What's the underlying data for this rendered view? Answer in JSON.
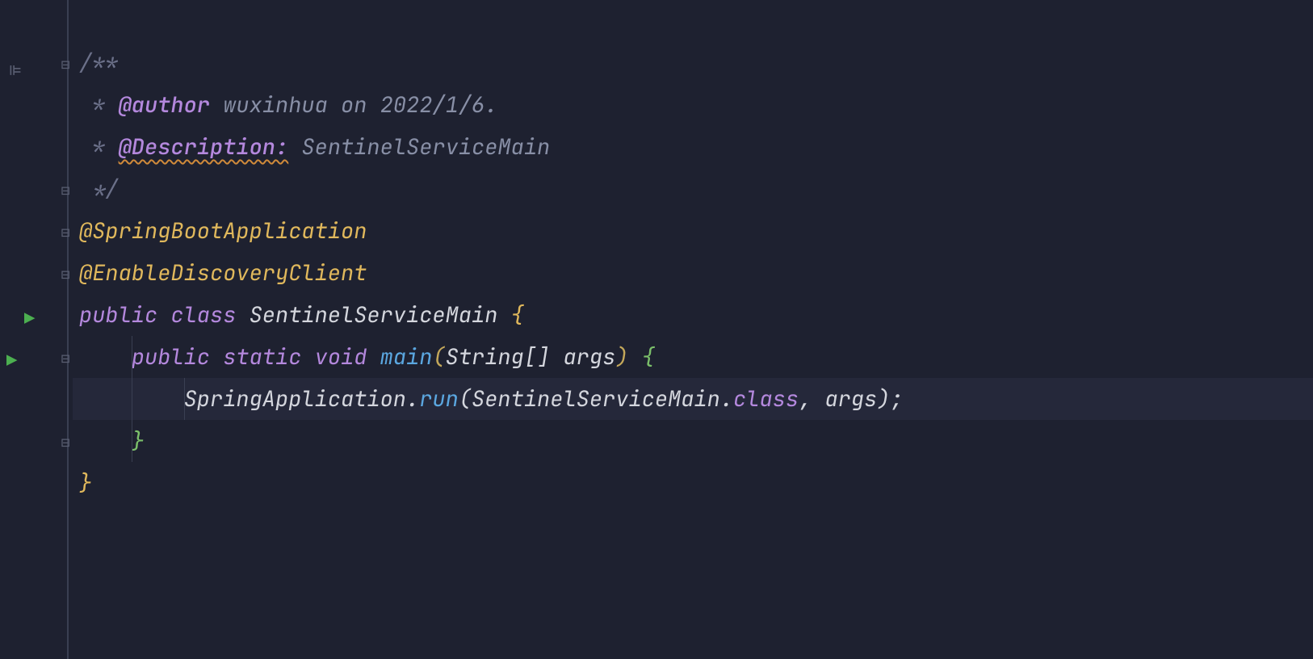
{
  "code": {
    "line1": {
      "comment_open": "/**"
    },
    "line2": {
      "prefix": " * ",
      "tag": "@author",
      "text": " wuxinhua on 2022/1/6."
    },
    "line3": {
      "prefix": " * ",
      "tag": "@Description:",
      "text": " SentinelServiceMain"
    },
    "line4": {
      "comment_close": " */"
    },
    "line5": {
      "annotation": "@SpringBootApplication"
    },
    "line6": {
      "annotation": "@EnableDiscoveryClient"
    },
    "line7": {
      "kw_public": "public",
      "kw_class": "class",
      "class_name": "SentinelServiceMain",
      "brace": "{"
    },
    "line8": {
      "kw_public": "public",
      "kw_static": "static",
      "kw_void": "void",
      "method": "main",
      "paren_open": "(",
      "type": "String[]",
      "param": "args",
      "paren_close": ")",
      "brace": "{"
    },
    "line9": {
      "obj": "SpringApplication",
      "dot": ".",
      "method": "run",
      "paren_open": "(",
      "arg1": "SentinelServiceMain",
      "dot2": ".",
      "class_kw": "class",
      "comma": ", ",
      "arg2": "args",
      "paren_close": ")",
      "semi": ";"
    },
    "line10": {
      "brace": "}"
    },
    "line11": {
      "brace": "}"
    }
  },
  "icons": {
    "structure": "⊫",
    "fold_minus": "⊟",
    "run": "▶"
  }
}
